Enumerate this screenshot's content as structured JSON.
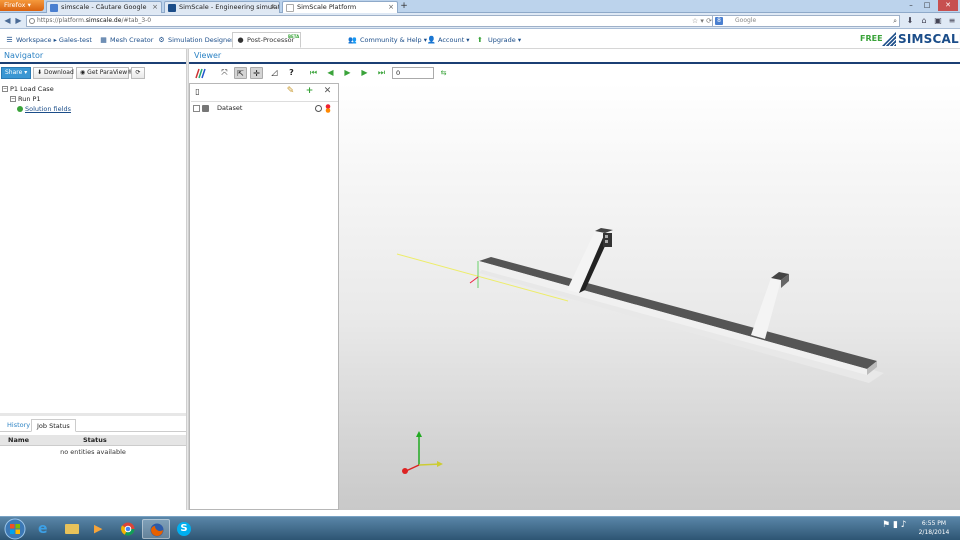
{
  "browser": {
    "firefox_label": "Firefox",
    "tabs": [
      {
        "label": "simscale - Căutare Google",
        "icon": "google-icon"
      },
      {
        "label": "SimScale - Engineering simulation in ...",
        "icon": "simscale-icon"
      },
      {
        "label": "SimScale Platform",
        "icon": "page-icon"
      }
    ],
    "new_tab": "+",
    "url_prefix": "https://platform.",
    "url_domain": "simscale.de",
    "url_path": "/#tab_3-0",
    "search_placeholder": "Google",
    "window_controls": {
      "minimize": "–",
      "maximize": "□",
      "close": "✕"
    }
  },
  "app": {
    "nav_tabs": [
      {
        "label": "Workspace ▸ Gales-test",
        "icon": "workspace-icon"
      },
      {
        "label": "Mesh Creator",
        "icon": "grid-icon"
      },
      {
        "label": "Simulation Designer",
        "icon": "gear-icon"
      },
      {
        "label": "Post-Processor",
        "icon": "dot-icon",
        "badge": "BETA",
        "active": true
      }
    ],
    "menus": [
      {
        "label": "Community & Help ▾",
        "icon": "users-icon"
      },
      {
        "label": "Account ▾",
        "icon": "user-icon"
      },
      {
        "label": "Upgrade ▾",
        "icon": "arrow-up-icon"
      }
    ],
    "plan": "FREE",
    "logo_text": "SIMSCALE"
  },
  "navigator": {
    "title": "Navigator",
    "buttons": {
      "share": "Share ▾",
      "download": "Download",
      "paraview": "Get ParaView®",
      "refresh": "⟳"
    },
    "tree": {
      "root": "P1 Load Case",
      "run": "Run P1",
      "leaf": "Solution fields"
    },
    "bottom_tabs": [
      "History",
      "Job Status"
    ],
    "job_columns": [
      "Name",
      "Status"
    ],
    "job_empty": "no entities available"
  },
  "viewer": {
    "title": "Viewer",
    "frame_value": "0",
    "pipeline": {
      "row_label": "Dataset"
    }
  },
  "taskbar": {
    "time": "6:55 PM",
    "date": "2/18/2014"
  },
  "colors": {
    "accent": "#2d83c4",
    "navy": "#1b3f74",
    "free_green": "#3aa33a"
  }
}
